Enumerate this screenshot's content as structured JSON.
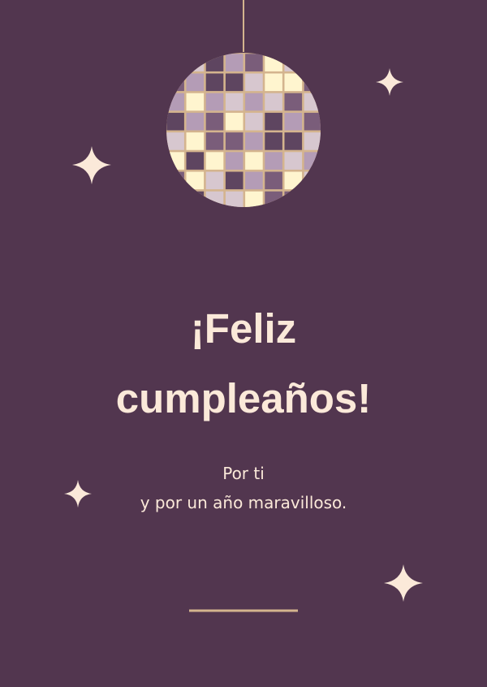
{
  "card": {
    "headline_line1": "¡Feliz",
    "headline_line2": "cumpleaños!",
    "message_line1": "Por ti",
    "message_line2": "y por un año maravilloso."
  },
  "colors": {
    "background": "#52364f",
    "text": "#fbe9d9",
    "accent_gold": "#d4b48e",
    "tile_cream": "#fff5cf",
    "tile_lilac": "#b49cb6",
    "tile_light": "#d7c7cf",
    "tile_purple": "#7a5d7a",
    "tile_dark": "#5e4560"
  },
  "icons": {
    "ornament": "disco-ball-icon",
    "sparkle": "four-point-star-icon"
  }
}
